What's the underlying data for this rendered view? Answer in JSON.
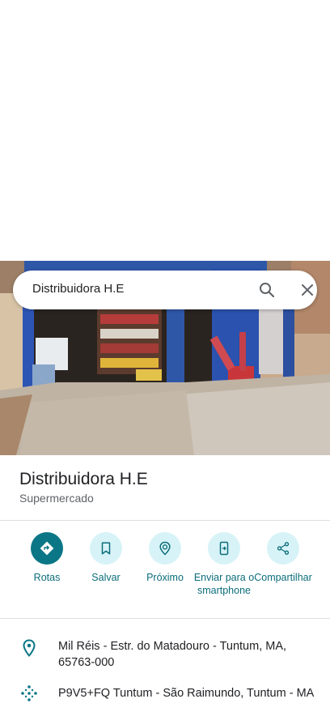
{
  "search": {
    "query": "Distribuidora H.E"
  },
  "place": {
    "name": "Distribuidora H.E",
    "category": "Supermercado"
  },
  "actions": [
    {
      "label": "Rotas",
      "icon": "directions-icon"
    },
    {
      "label": "Salvar",
      "icon": "bookmark-icon"
    },
    {
      "label": "Próximo",
      "icon": "nearby-icon"
    },
    {
      "label": "Enviar para o smartphone",
      "icon": "send-to-phone-icon"
    },
    {
      "label": "Compartilhar",
      "icon": "share-icon"
    }
  ],
  "details": {
    "address": "Mil Réis - Estr. do Matadouro - Tuntum, MA, 65763-000",
    "plus_code": "P9V5+FQ Tuntum - São Raimundo, Tuntum - MA"
  },
  "colors": {
    "accent": "#0b7686",
    "action_bg": "#d7f3f7",
    "action_text": "#0b6d7a"
  }
}
